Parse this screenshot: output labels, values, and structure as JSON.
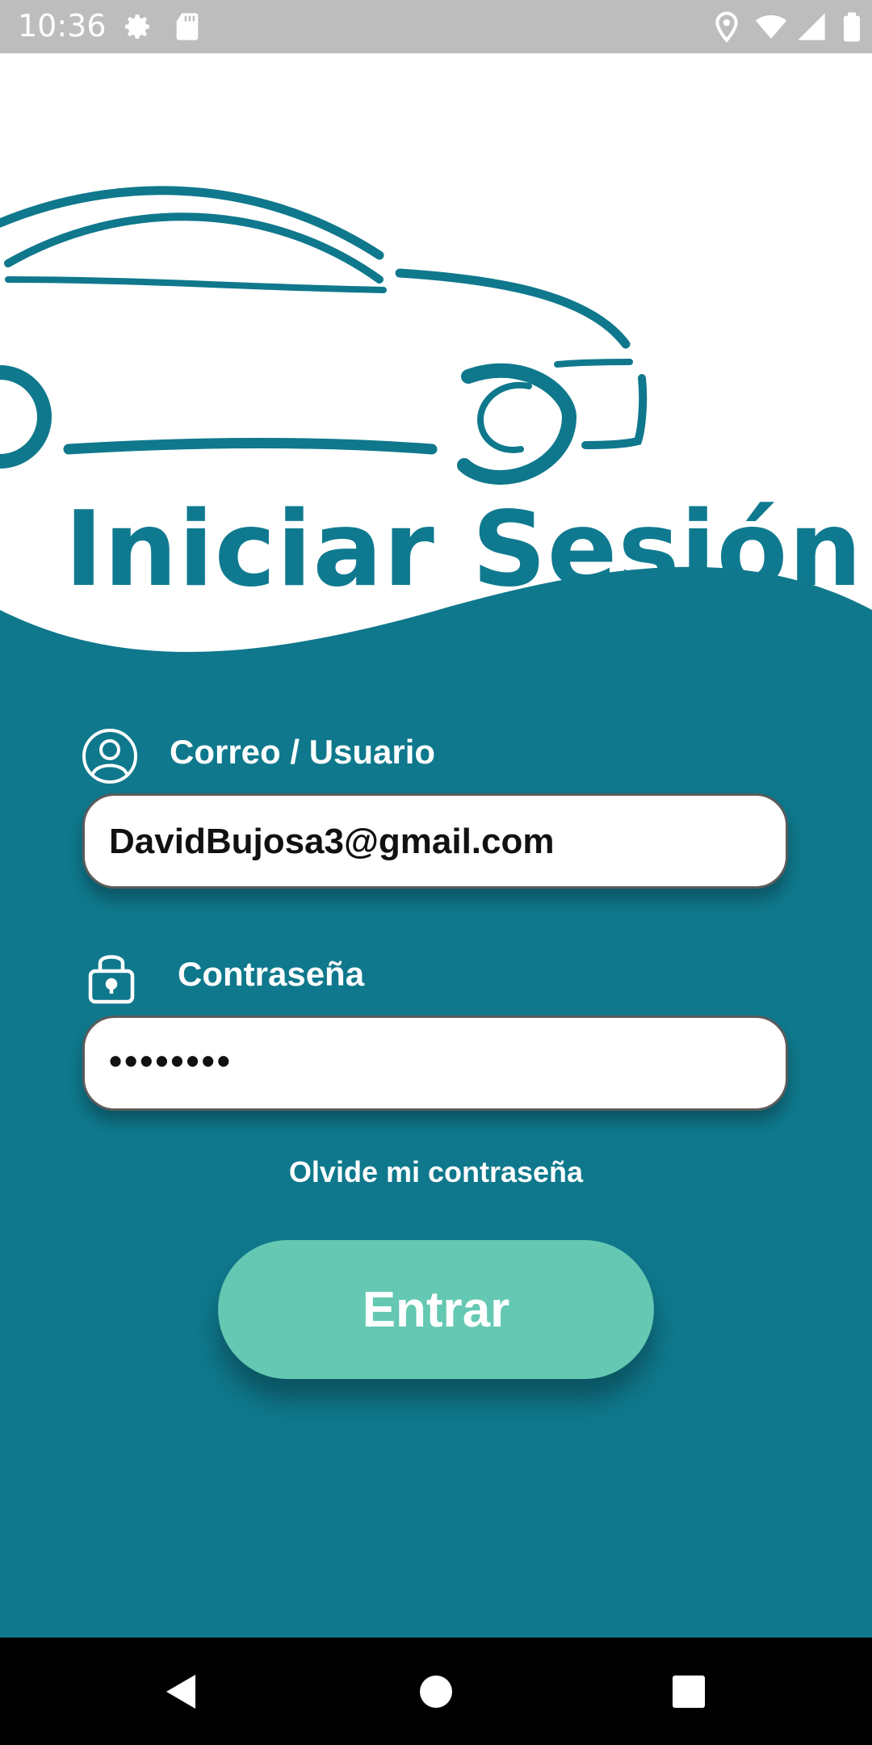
{
  "status_bar": {
    "time": "10:36",
    "icons": [
      "gear-icon",
      "sd-card-icon",
      "location-icon",
      "wifi-icon",
      "signal-icon",
      "battery-icon"
    ]
  },
  "header": {
    "logo": "car-logo",
    "title": "Iniciar Sesión"
  },
  "form": {
    "email_label": "Correo / Usuario",
    "email_value": "DavidBujosa3@gmail.com",
    "password_label": "Contraseña",
    "password_value": "••••••••",
    "forgot_link": "Olvide mi contraseña",
    "submit_label": "Entrar"
  },
  "nav_bar": {
    "buttons": [
      "back-icon",
      "home-icon",
      "recents-icon"
    ]
  },
  "colors": {
    "primary": "#0f788c",
    "accent": "#64c8b2",
    "status_bar": "#bdbdbd"
  }
}
